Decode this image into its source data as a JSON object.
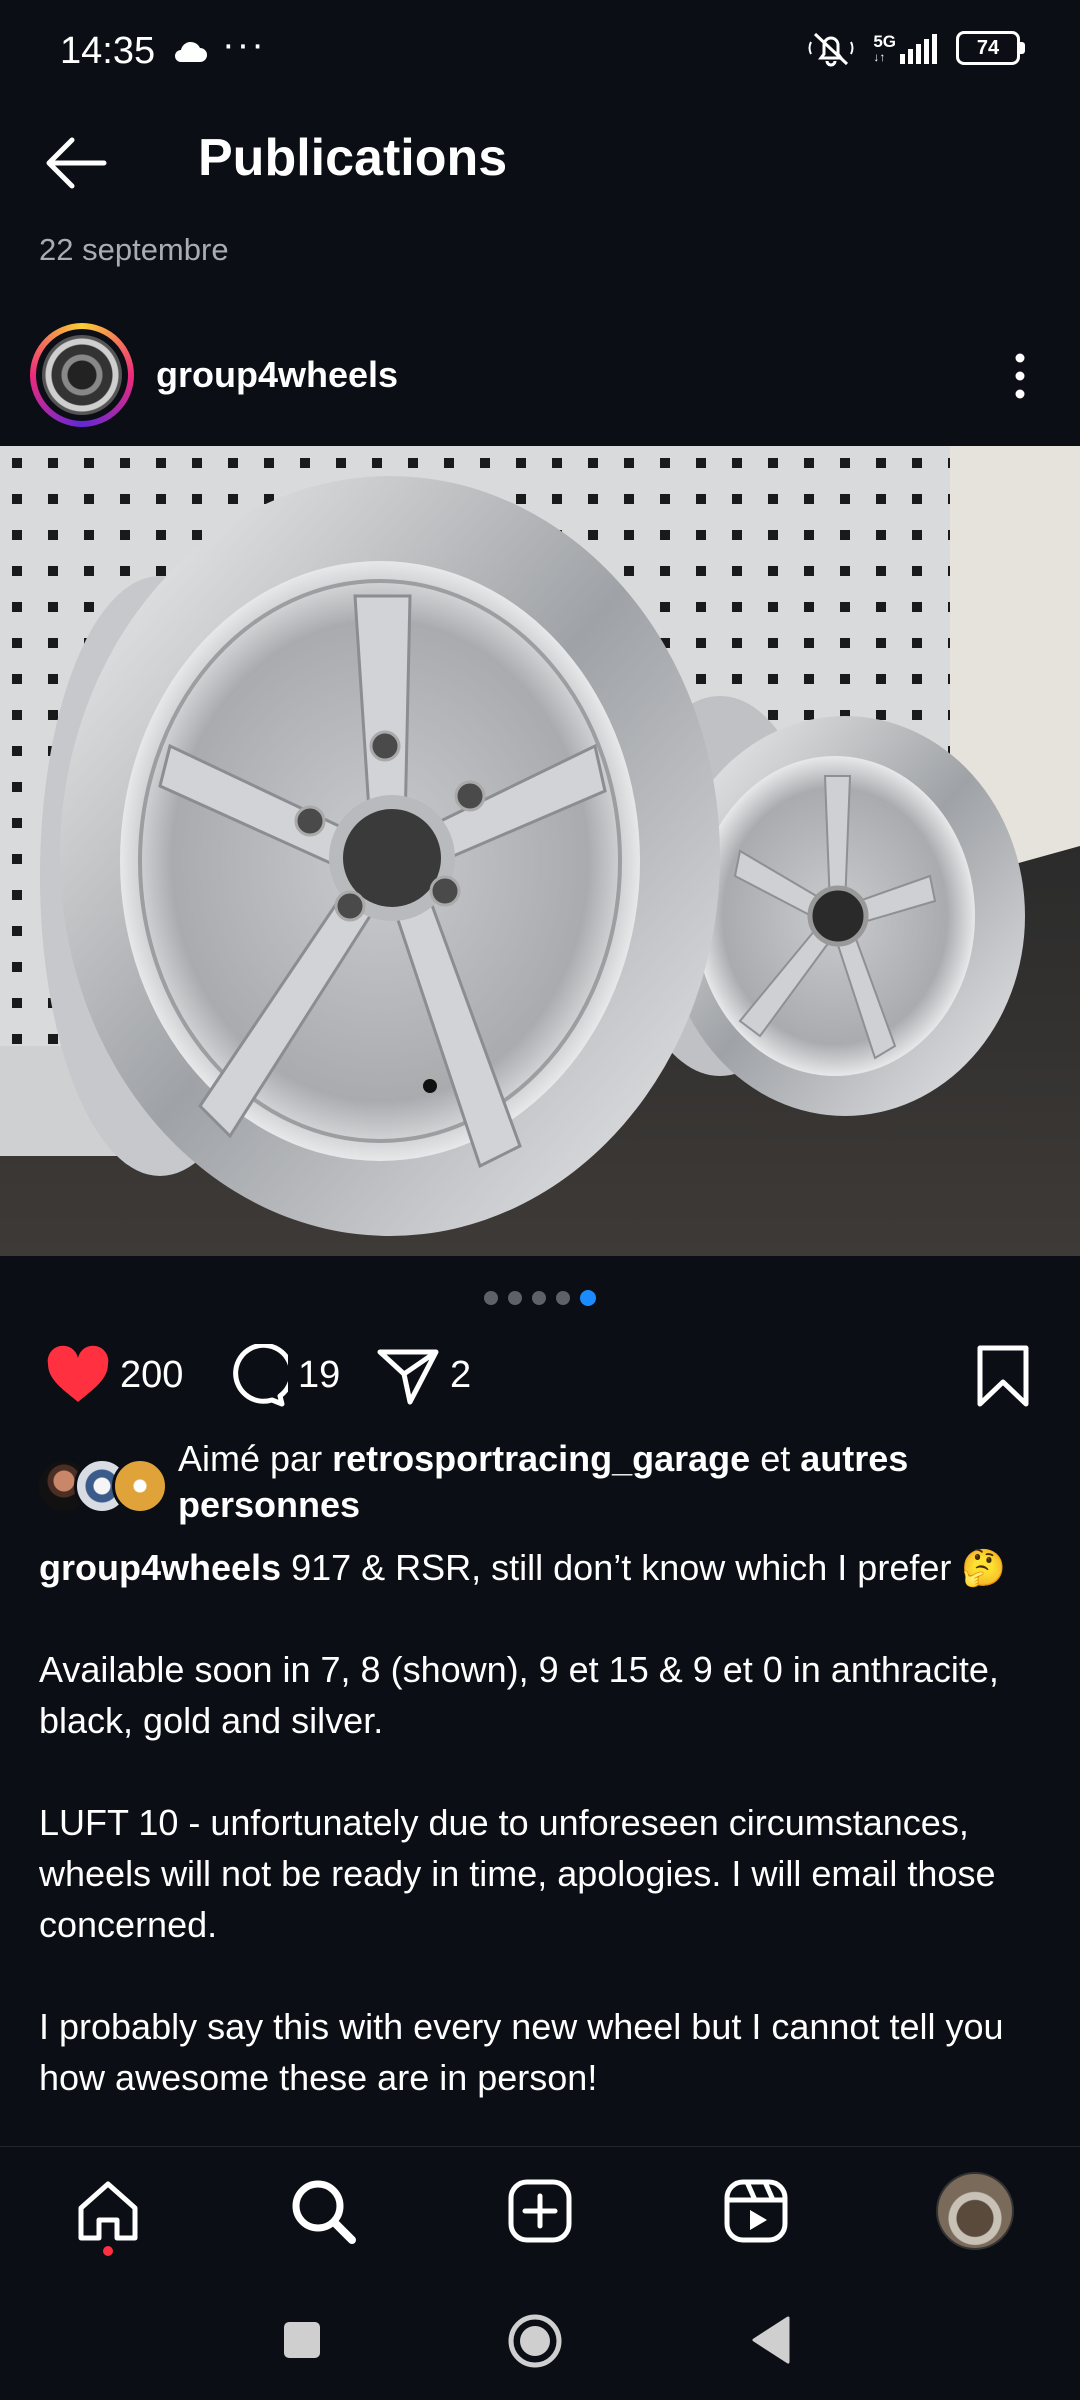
{
  "status_bar": {
    "time": "14:35",
    "network": "5G",
    "battery": "74",
    "icons": [
      "cloud-icon",
      "overflow-dots-icon",
      "mute-icon",
      "signal-icon",
      "battery-icon"
    ]
  },
  "header": {
    "title": "Publications",
    "date": "22 septembre"
  },
  "post": {
    "username": "group4wheels",
    "carousel": {
      "count": 5,
      "active_index": 4
    },
    "likes": "200",
    "comments": "19",
    "shares": "2",
    "liked_by": {
      "prefix": "Aimé par ",
      "user": "retrosportracing_garage",
      "middle": " et ",
      "others": "autres personnes"
    },
    "caption": {
      "user": "group4wheels",
      "line1": " 917 & RSR, still don’t know which I prefer 🤔",
      "para2": "Available soon in 7, 8 (shown), 9 et 15 & 9 et 0 in anthracite, black, gold and silver.",
      "para3": "LUFT 10 - unfortunately due to unforeseen circumstances, wheels will not be ready in time, apologies. I will email those concerned.",
      "para4": "I probably say this with every new wheel but I cannot tell you how awesome these are in person!"
    }
  },
  "colors": {
    "background": "#0b0e14",
    "like": "#ff3040",
    "carousel_active": "#1a8cff",
    "muted_text": "#a8acb3"
  },
  "bottom_nav": [
    "home-icon",
    "search-icon",
    "create-icon",
    "reels-icon",
    "profile-avatar"
  ],
  "system_nav": [
    "recents-button",
    "home-button",
    "back-button"
  ]
}
